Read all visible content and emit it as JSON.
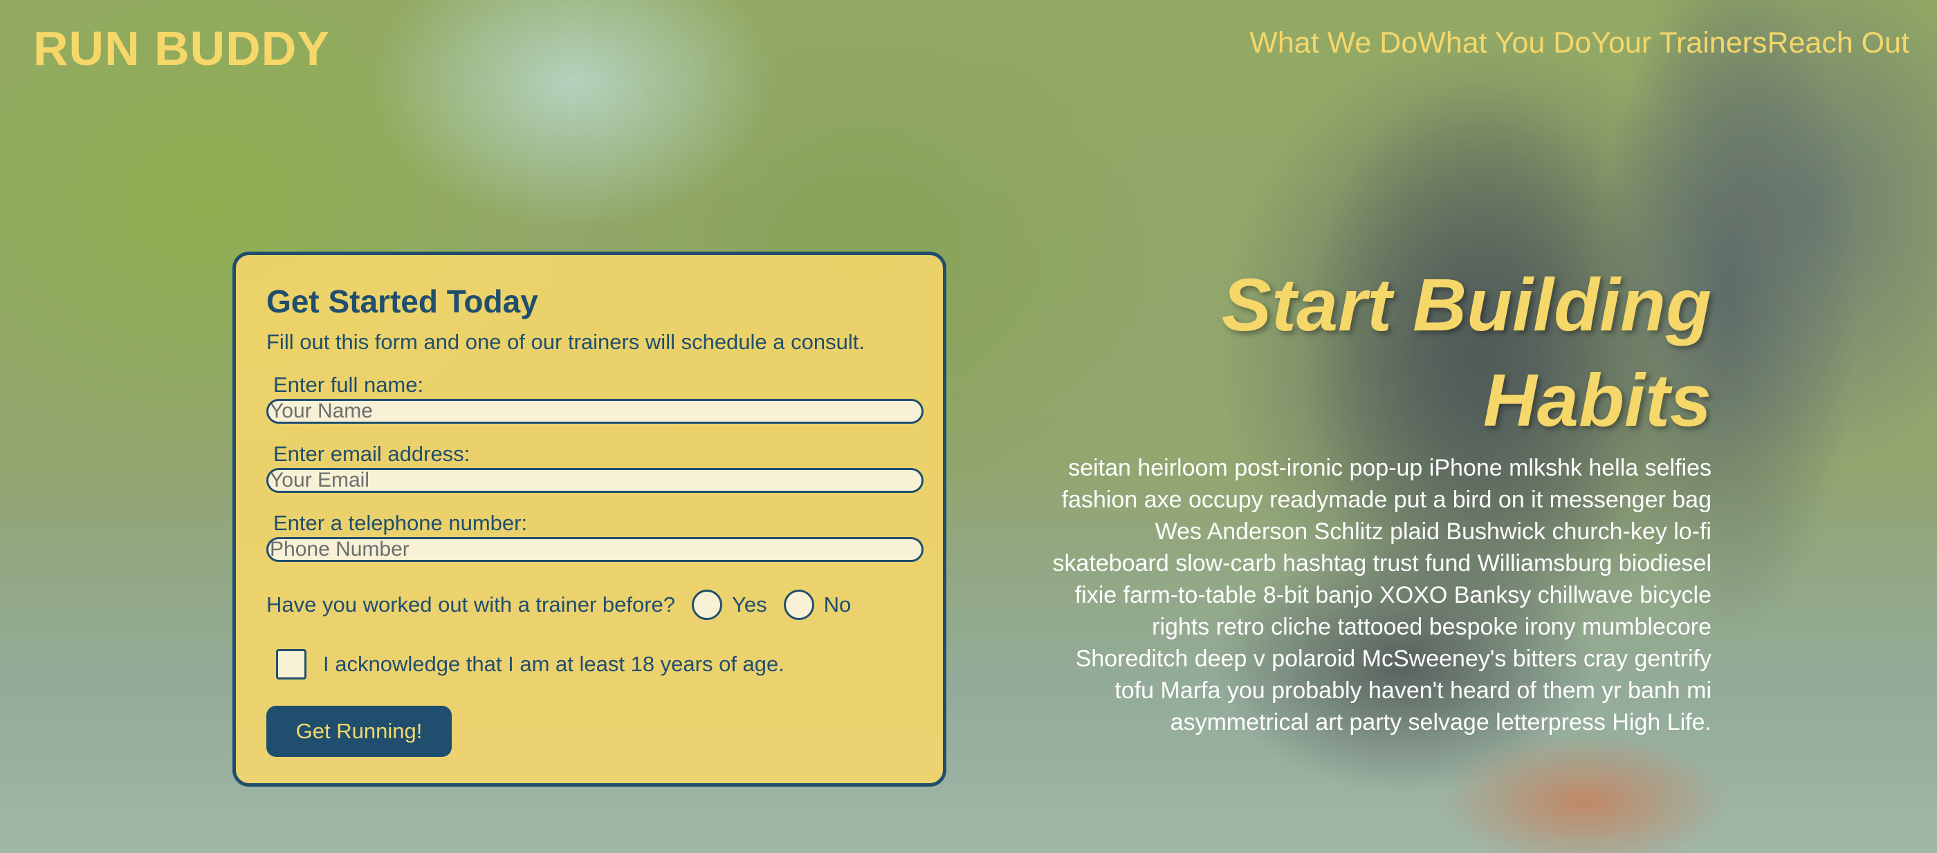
{
  "header": {
    "logo": "RUN BUDDY",
    "nav": [
      "What We Do",
      "What You Do",
      "Your Trainers",
      "Reach Out"
    ]
  },
  "form": {
    "title": "Get Started Today",
    "subtitle": "Fill out this form and one of our trainers will schedule a consult.",
    "fields": [
      {
        "label": "Enter full name:",
        "placeholder": "Your Name",
        "value": ""
      },
      {
        "label": "Enter email address:",
        "placeholder": "Your Email",
        "value": ""
      },
      {
        "label": "Enter a telephone number:",
        "placeholder": "Phone Number",
        "value": ""
      }
    ],
    "trainer_question": "Have you worked out with a trainer before?",
    "options": [
      "Yes",
      "No"
    ],
    "acknowledge": "I acknowledge that I am at least 18 years of age.",
    "submit_label": "Get Running!"
  },
  "hero": {
    "title_line1": "Start Building",
    "title_line2": "Habits",
    "body": "seitan heirloom post-ironic pop-up iPhone mlkshk hella selfies fashion axe occupy readymade put a bird on it messenger bag Wes Anderson Schlitz plaid Bushwick church-key lo-fi skateboard slow-carb hashtag trust fund Williamsburg biodiesel fixie farm-to-table 8-bit banjo XOXO Banksy chillwave bicycle rights retro cliche tattooed bespoke irony mumblecore Shoreditch deep v polaroid McSweeney's bitters cray gentrify tofu Marfa you probably haven't heard of them yr banh mi asymmetrical art party selvage letterpress High Life."
  },
  "colors": {
    "accent": "#f5d76a",
    "primary": "#1f4e6e"
  }
}
